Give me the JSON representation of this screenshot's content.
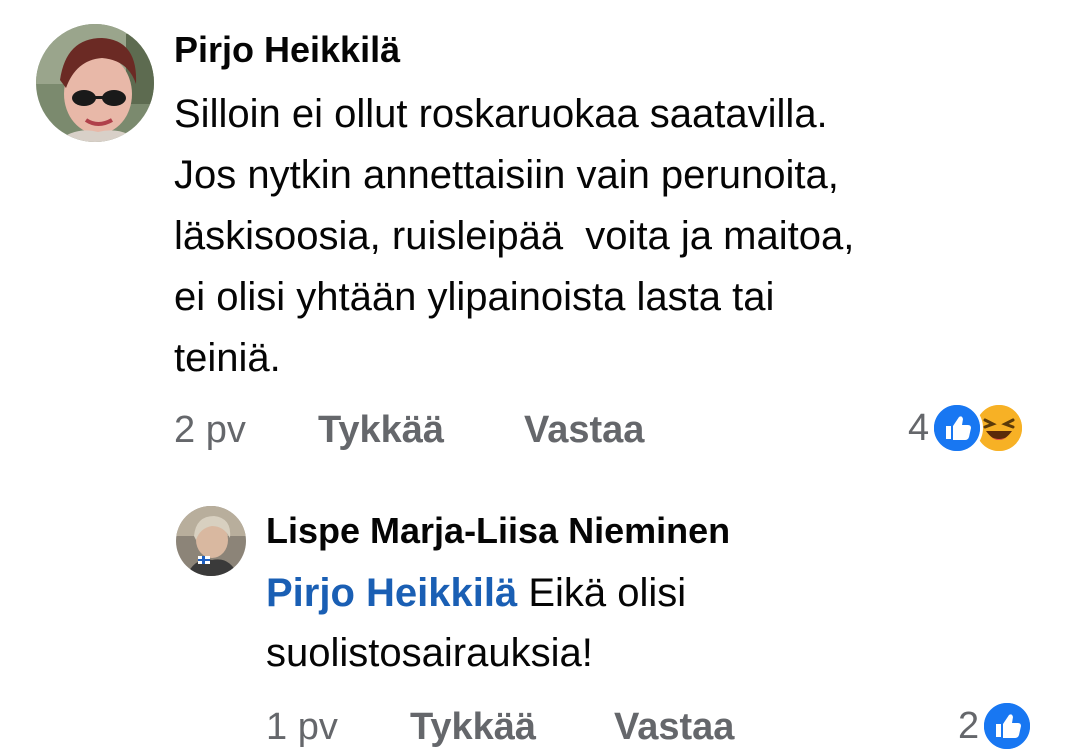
{
  "comments": [
    {
      "author": "Pirjo Heikkilä",
      "lines": [
        "Silloin ei ollut roskaruokaa saatavilla.",
        "Jos nytkin annettaisiin vain perunoita,",
        "läskisoosia, ruisleipää  voita ja maitoa,",
        "ei olisi yhtään ylipainoista lasta tai",
        "teiniä."
      ],
      "time": "2 pv",
      "like_label": "Tykkää",
      "reply_label": "Vastaa",
      "reaction_count": "4",
      "reactions": [
        "like-icon",
        "haha-icon"
      ]
    },
    {
      "author": "Lispe Marja-Liisa Nieminen",
      "mention": "Pirjo Heikkilä",
      "line1_rest": " Eikä olisi",
      "line2": "suolistosairauksia!",
      "time": "1 pv",
      "like_label": "Tykkää",
      "reply_label": "Vastaa",
      "reaction_count": "2",
      "reactions": [
        "like-icon"
      ]
    }
  ],
  "colors": {
    "text": "#050505",
    "meta": "#65676b",
    "mention": "#1a5fb4",
    "like_blue": "#1877f2",
    "haha_yellow": "#f7b125"
  }
}
